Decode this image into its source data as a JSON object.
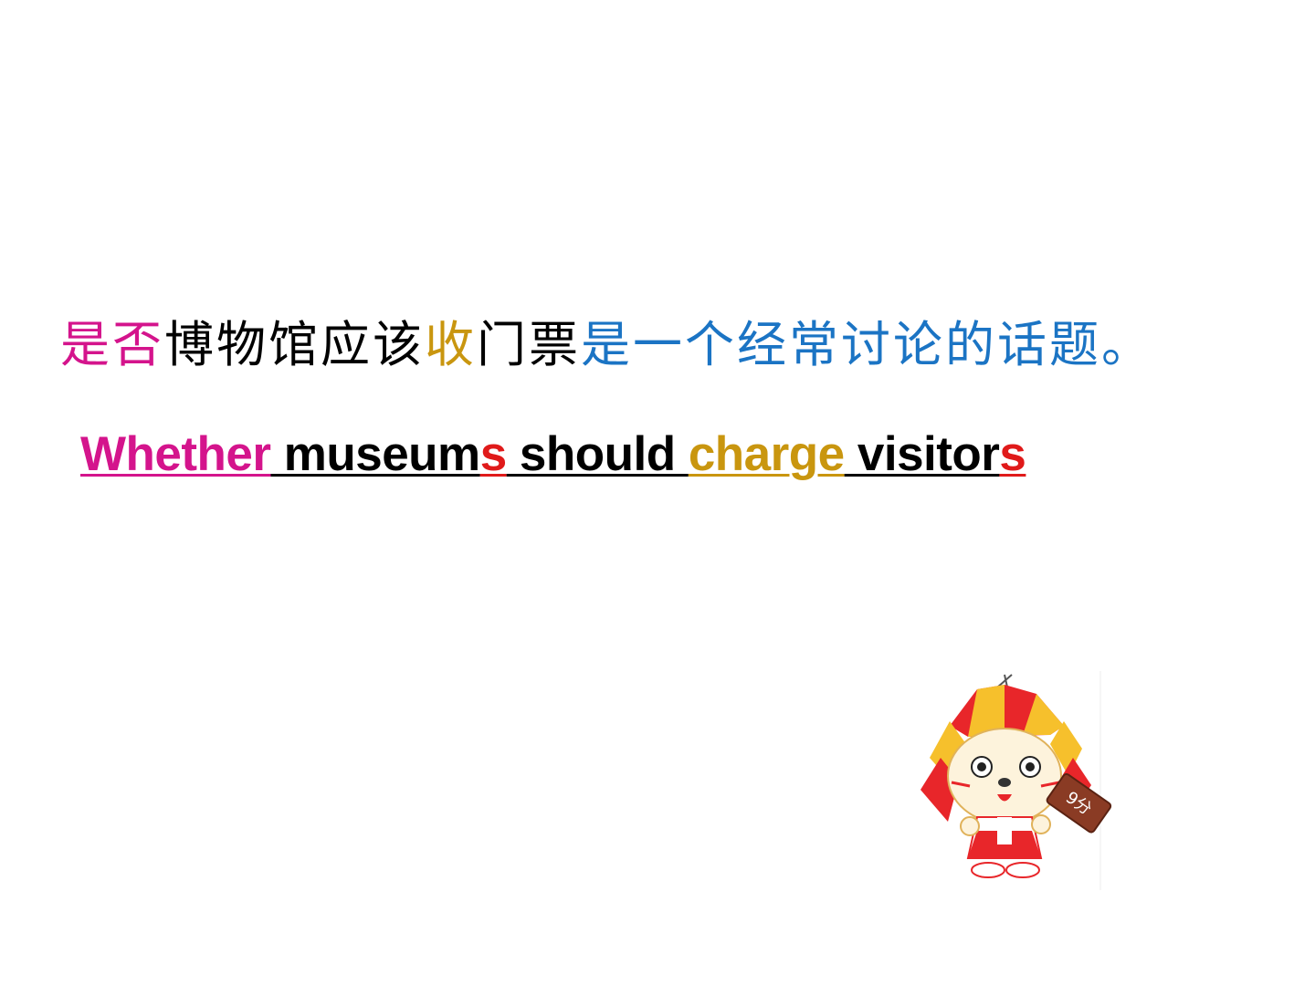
{
  "colors": {
    "magenta": "#d4148c",
    "black": "#000000",
    "gold": "#c9960f",
    "blue": "#1b74c4",
    "red": "#e01a1a"
  },
  "chinese_sentence": {
    "seg1": "是否",
    "seg2": "博物馆应该",
    "seg3": "收",
    "seg4": "门票",
    "seg5": "是一个经常讨论的话题。"
  },
  "english_phrase": {
    "w1": "Whether",
    "w2": " museum",
    "w3": "s",
    "w4": " should ",
    "w5": "charge",
    "w6": " visitor",
    "w7": "s"
  },
  "mascot": {
    "icon": "cartoon-dog-mascot-icon",
    "badge_text": "9分"
  }
}
